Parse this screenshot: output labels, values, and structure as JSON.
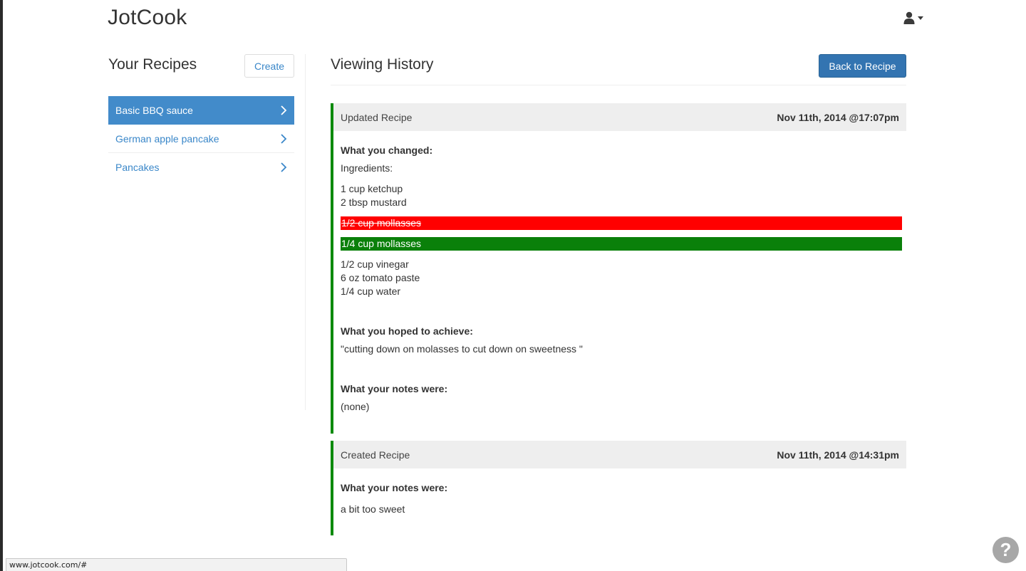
{
  "app": {
    "brand": "JotCook"
  },
  "sidebar": {
    "title": "Your Recipes",
    "create_label": "Create",
    "recipes": [
      {
        "label": "Basic BBQ sauce",
        "active": true
      },
      {
        "label": "German apple pancake",
        "active": false
      },
      {
        "label": "Pancakes",
        "active": false
      }
    ]
  },
  "main": {
    "title": "Viewing History",
    "back_label": "Back to Recipe",
    "entries": [
      {
        "kind": "Updated Recipe",
        "timestamp": "Nov 11th, 2014 @17:07pm",
        "changed_label": "What you changed:",
        "section": "Ingredients:",
        "unchanged_before": [
          "1 cup ketchup",
          "2 tbsp mustard"
        ],
        "removed": "1/2 cup mollasses",
        "added": "1/4 cup mollasses",
        "unchanged_after": [
          "1/2 cup vinegar",
          "6 oz tomato paste",
          "1/4 cup water"
        ],
        "hoped_label": "What you hoped to achieve:",
        "hoped_text": "\"cutting down on molasses to cut down on sweetness \"",
        "notes_label": "What your notes were:",
        "notes_text": "(none)"
      },
      {
        "kind": "Created Recipe",
        "timestamp": "Nov 11th, 2014 @14:31pm",
        "notes_label": "What your notes were:",
        "notes_text": "a bit too sweet"
      }
    ]
  },
  "status_bar": {
    "url": "www.jotcook.com/#"
  },
  "help": {
    "label": "?"
  },
  "colors": {
    "accent": "#428bca",
    "link": "#3a87c9",
    "button_primary": "#3374b1",
    "diff_removed": "#ff0000",
    "diff_added": "#0a800a",
    "entry_border": "#0a8a0a"
  },
  "icons": {
    "user": "user-icon",
    "caret": "caret-down-icon",
    "chevron": "chevron-right-icon",
    "help": "question-mark-icon"
  }
}
